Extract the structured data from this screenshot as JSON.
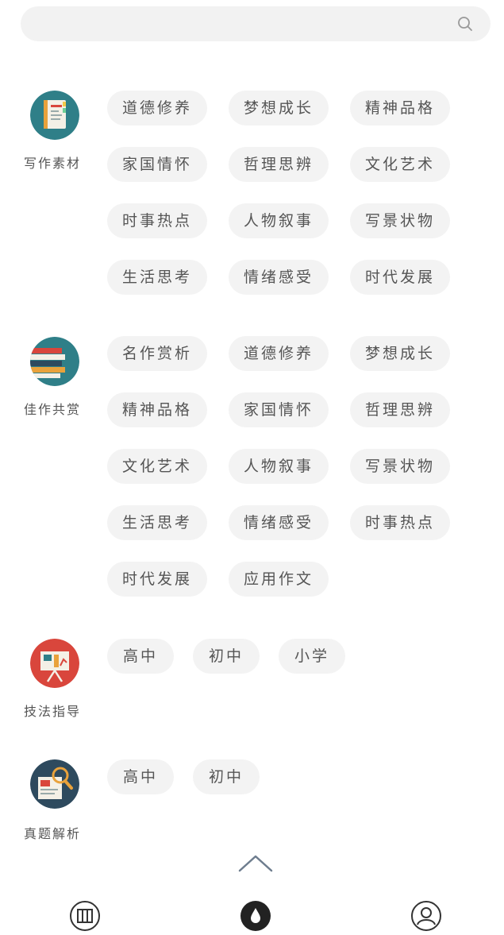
{
  "categories": [
    {
      "label": "写作素材",
      "chips": [
        "道德修养",
        "梦想成长",
        "精神品格",
        "家国情怀",
        "哲理思辨",
        "文化艺术",
        "时事热点",
        "人物叙事",
        "写景状物",
        "生活思考",
        "情绪感受",
        "时代发展"
      ]
    },
    {
      "label": "佳作共赏",
      "chips": [
        "名作赏析",
        "道德修养",
        "梦想成长",
        "精神品格",
        "家国情怀",
        "哲理思辨",
        "文化艺术",
        "人物叙事",
        "写景状物",
        "生活思考",
        "情绪感受",
        "时事热点",
        "时代发展",
        "应用作文"
      ]
    },
    {
      "label": "技法指导",
      "chips": [
        "高中",
        "初中",
        "小学"
      ]
    },
    {
      "label": "真题解析",
      "chips": [
        "高中",
        "初中"
      ]
    }
  ],
  "colors": {
    "chip_bg": "#f3f3f3",
    "search_bg": "#f2f2f2",
    "text": "#555555",
    "icon_teal": "#2f7f88",
    "icon_red": "#d9463c",
    "icon_navy": "#2e4a5e"
  },
  "icons": {
    "search": "search-icon",
    "back_to_top": "chevron-up-icon",
    "tab_left": "book-icon",
    "tab_center": "ink-drop-icon",
    "tab_right": "profile-icon"
  }
}
